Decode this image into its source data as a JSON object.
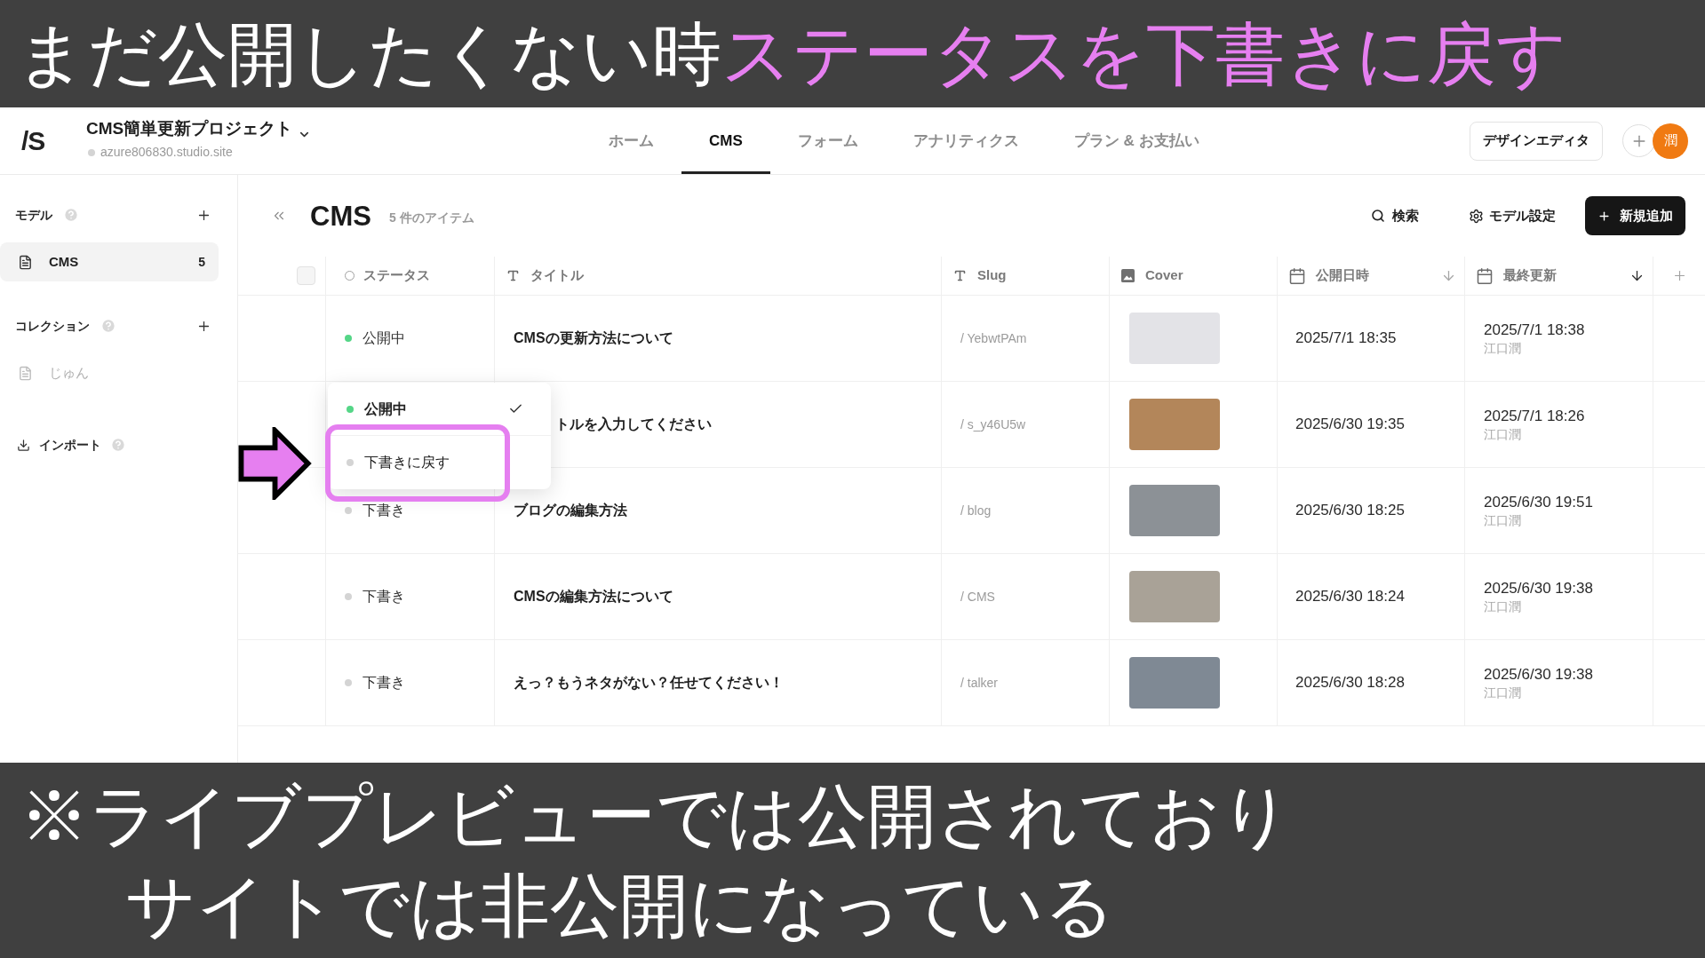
{
  "banner_top": {
    "parts": [
      {
        "text": "まだ公開したくない時",
        "kind": "plain"
      },
      {
        "text": "ステータスを下書きに戻す",
        "kind": "accent"
      }
    ]
  },
  "header": {
    "logo": "/S",
    "project": {
      "name": "CMS簡単更新プロジェクト",
      "url": "azure806830.studio.site"
    },
    "nav": [
      {
        "label": "ホーム",
        "selected": false
      },
      {
        "label": "CMS",
        "selected": true
      },
      {
        "label": "フォーム",
        "selected": false
      },
      {
        "label": "アナリティクス",
        "selected": false
      },
      {
        "label": "プラン & お支払い",
        "selected": false
      }
    ],
    "design_editor_button": "デザインエディタ",
    "avatar": "潤"
  },
  "sidebar": {
    "sections": [
      {
        "title": "モデル",
        "items": [
          {
            "label": "CMS",
            "count": "5",
            "selected": true,
            "disabled": false
          }
        ]
      },
      {
        "title": "コレクション",
        "items": [
          {
            "label": "じゅん",
            "selected": false,
            "disabled": true
          }
        ]
      }
    ],
    "import": "インポート"
  },
  "main": {
    "title": "CMS",
    "count": "5 件のアイテム",
    "search": "検索",
    "settings": "モデル設定",
    "add_button": "新規追加"
  },
  "table": {
    "select_all": {
      "checked": false
    },
    "columns": [
      {
        "label": "ステータス",
        "kind": "status",
        "sorted": false
      },
      {
        "label": "タイトル",
        "kind": "text",
        "sorted": false
      },
      {
        "label": "Slug",
        "kind": "text",
        "sorted": false
      },
      {
        "label": "Cover",
        "kind": "image",
        "sorted": false
      },
      {
        "label": "公開日時",
        "kind": "date",
        "sorted": false
      },
      {
        "label": "最終更新",
        "kind": "date",
        "sorted": true
      }
    ],
    "rows": [
      {
        "status": "公開中",
        "color": "#55d687",
        "title": "CMSの更新方法について",
        "slug": "/ YebwtPAm",
        "published": "2025/7/1 18:35",
        "updated": "2025/7/1 18:38",
        "editor": "江口潤"
      },
      {
        "status_menu": {
          "options": [
            {
              "label": "公開中",
              "color": "#55d687",
              "selected": true,
              "highlighted": false
            },
            {
              "label": "下書きに戻す",
              "color": "#d4d4d4",
              "selected": false,
              "highlighted": true
            }
          ]
        },
        "title": "トルを入力してください",
        "slug": "/ s_y46U5w",
        "published": "2025/6/30 19:35",
        "updated": "2025/7/1 18:26",
        "editor": "江口潤"
      },
      {
        "status": "下書き",
        "color": "#d4d4d4",
        "title": "ブログの編集方法",
        "slug": "/ blog",
        "published": "2025/6/30 18:25",
        "updated": "2025/6/30 19:51",
        "editor": "江口潤"
      },
      {
        "status": "下書き",
        "color": "#d4d4d4",
        "title": "CMSの編集方法について",
        "slug": "/ CMS",
        "published": "2025/6/30 18:24",
        "updated": "2025/6/30 19:38",
        "editor": "江口潤"
      },
      {
        "status": "下書き",
        "color": "#d4d4d4",
        "title": "えっ？もうネタがない？任せてください！",
        "slug": "/ talker",
        "published": "2025/6/30 18:28",
        "updated": "2025/6/30 19:38",
        "editor": "江口潤"
      }
    ]
  },
  "banner_bottom": {
    "lines": [
      "※ライブプレビューでは公開されており",
      "サイトでは非公開になっている"
    ]
  }
}
